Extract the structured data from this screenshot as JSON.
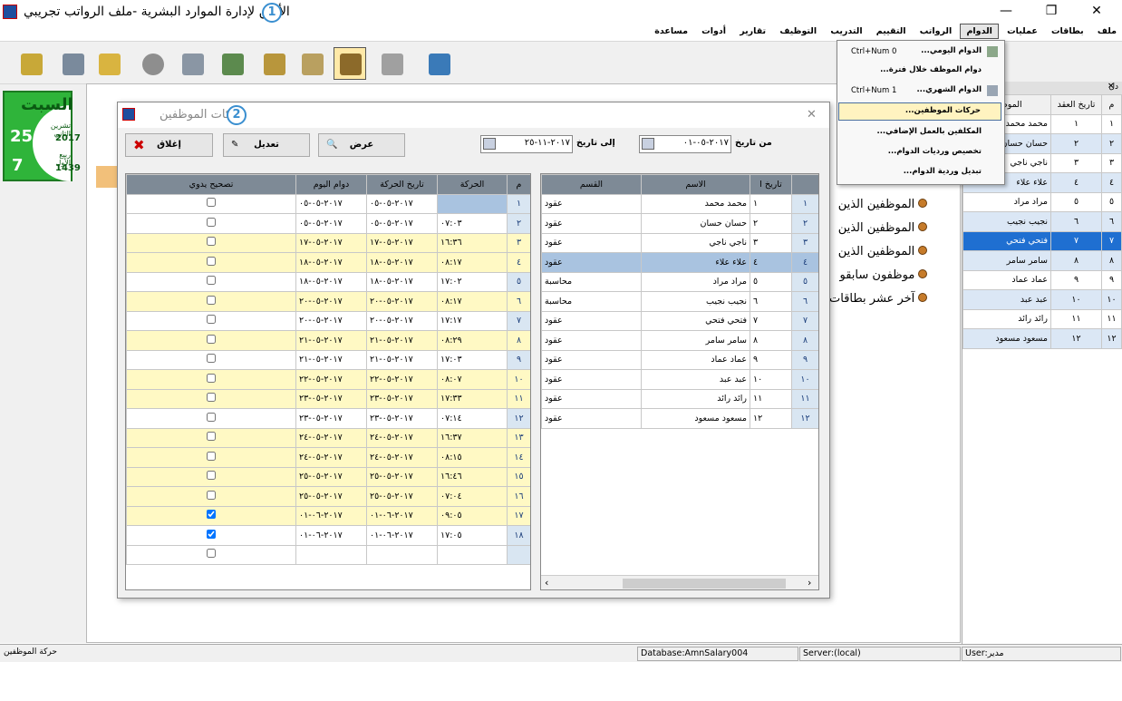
{
  "window": {
    "title": "الأمين لإدارة الموارد البشرية -ملف الرواتب تجريبي",
    "badge1": "1",
    "minimize": "—",
    "maximize": "❐",
    "close": "✕"
  },
  "menu": [
    "ملف",
    "بطاقات",
    "عمليات",
    "الدوام",
    "الرواتب",
    "التقييم",
    "التدريب",
    "التوظيف",
    "تقارير",
    "أدوات",
    "مساعدة"
  ],
  "dropdown": [
    {
      "label": "الدوام اليومي...",
      "shortcut": "Ctrl+Num 0"
    },
    {
      "label": "دوام الموظف خلال فترة...",
      "shortcut": ""
    },
    {
      "label": "الدوام الشهري...",
      "shortcut": "Ctrl+Num 1"
    },
    {
      "label": "حركات الموظفين...",
      "shortcut": ""
    },
    {
      "label": "المكلفين بالعمل الإضافي...",
      "shortcut": ""
    },
    {
      "label": "تخصيص ورديات الدوام...",
      "shortcut": ""
    },
    {
      "label": "تبديل وردية الدوام...",
      "shortcut": ""
    }
  ],
  "date": {
    "day": "السبت",
    "num1": "25",
    "month1": "تشرين الثاني",
    "year1": "2017",
    "num2": "7",
    "month2": "ربيع الأول",
    "year2": "1439"
  },
  "links": [
    "الموظفين الذين",
    "الموظفين الذين",
    "الموظفين الذين",
    "موظفون سابقو",
    "آخر عشر بطاقات"
  ],
  "side": {
    "title": "دل",
    "close": "×",
    "cols": [
      "م",
      "تاريخ العقد",
      "الموظف"
    ],
    "rows": [
      [
        "١",
        "١",
        "محمد محمد"
      ],
      [
        "٢",
        "٢",
        "حسان حسان"
      ],
      [
        "٣",
        "٣",
        "ناجي ناجي"
      ],
      [
        "٤",
        "٤",
        "علاء علاء"
      ],
      [
        "٥",
        "٥",
        "مراد مراد"
      ],
      [
        "٦",
        "٦",
        "نجيب نجيب"
      ],
      [
        "٧",
        "٧",
        "فتحي فتحي"
      ],
      [
        "٨",
        "٨",
        "سامر سامر"
      ],
      [
        "٩",
        "٩",
        "عماد عماد"
      ],
      [
        "١٠",
        "١٠",
        "عبد عبد"
      ],
      [
        "١١",
        "١١",
        "رائد رائد"
      ],
      [
        "١٢",
        "١٢",
        "مسعود مسعود"
      ]
    ]
  },
  "dialog": {
    "title": "حركات الموظفين",
    "badge2": "2",
    "from_label": "من تاريخ",
    "from_value": "٢٠١٧-٠٥-٠١",
    "to_label": "إلى تاريخ",
    "to_value": "٢٠١٧-١١-٢٥",
    "show": "عرض",
    "edit": "تعديل",
    "close": "إغلاق",
    "close_x": "✕",
    "emp_cols": [
      "القسم",
      "الاسم",
      "تاريخ ا"
    ],
    "emp_rows": [
      [
        "١",
        "١",
        "محمد محمد",
        "عقود"
      ],
      [
        "٢",
        "٢",
        "حسان حسان",
        "عقود"
      ],
      [
        "٣",
        "٣",
        "ناجي ناجي",
        "عقود"
      ],
      [
        "٤",
        "٤",
        "علاء علاء",
        "عقود"
      ],
      [
        "٥",
        "٥",
        "مراد مراد",
        "محاسبة"
      ],
      [
        "٦",
        "٦",
        "نجيب نجيب",
        "محاسبة"
      ],
      [
        "٧",
        "٧",
        "فتحي فتحي",
        "عقود"
      ],
      [
        "٨",
        "٨",
        "سامر سامر",
        "عقود"
      ],
      [
        "٩",
        "٩",
        "عماد عماد",
        "عقود"
      ],
      [
        "١٠",
        "١٠",
        "عبد عبد",
        "عقود"
      ],
      [
        "١١",
        "١١",
        "رائد رائد",
        "عقود"
      ],
      [
        "١٢",
        "١٢",
        "مسعود مسعود",
        "عقود"
      ]
    ],
    "mv_cols": [
      "م",
      "الحركة",
      "تاريخ الحركة",
      "دوام اليوم",
      "تصحيح يدوي"
    ],
    "mv_rows": [
      [
        "١",
        "",
        "٢٠١٧-٠٥-٠٥",
        "٢٠١٧-٠٥-٠٥",
        false
      ],
      [
        "٢",
        "٠٧:٠٣",
        "٢٠١٧-٠٥-٠٥",
        "٢٠١٧-٠٥-٠٥",
        false
      ],
      [
        "٣",
        "١٦:٣٦",
        "٢٠١٧-٠٥-١٧",
        "٢٠١٧-٠٥-١٧",
        false
      ],
      [
        "٤",
        "٠٨:١٧",
        "٢٠١٧-٠٥-١٨",
        "٢٠١٧-٠٥-١٨",
        false
      ],
      [
        "٥",
        "١٧:٠٢",
        "٢٠١٧-٠٥-١٨",
        "٢٠١٧-٠٥-١٨",
        false
      ],
      [
        "٦",
        "٠٨:١٧",
        "٢٠١٧-٠٥-٢٠",
        "٢٠١٧-٠٥-٢٠",
        false
      ],
      [
        "٧",
        "١٧:١٧",
        "٢٠١٧-٠٥-٢٠",
        "٢٠١٧-٠٥-٢٠",
        false
      ],
      [
        "٨",
        "٠٨:٢٩",
        "٢٠١٧-٠٥-٢١",
        "٢٠١٧-٠٥-٢١",
        false
      ],
      [
        "٩",
        "١٧:٠٣",
        "٢٠١٧-٠٥-٢١",
        "٢٠١٧-٠٥-٢١",
        false
      ],
      [
        "١٠",
        "٠٨:٠٧",
        "٢٠١٧-٠٥-٢٢",
        "٢٠١٧-٠٥-٢٢",
        false
      ],
      [
        "١١",
        "١٧:٣٣",
        "٢٠١٧-٠٥-٢٣",
        "٢٠١٧-٠٥-٢٣",
        false
      ],
      [
        "١٢",
        "٠٧:١٤",
        "٢٠١٧-٠٥-٢٣",
        "٢٠١٧-٠٥-٢٣",
        false
      ],
      [
        "١٣",
        "١٦:٣٧",
        "٢٠١٧-٠٥-٢٤",
        "٢٠١٧-٠٥-٢٤",
        false
      ],
      [
        "١٤",
        "٠٨:١٥",
        "٢٠١٧-٠٥-٢٤",
        "٢٠١٧-٠٥-٢٤",
        false
      ],
      [
        "١٥",
        "١٦:٤٦",
        "٢٠١٧-٠٥-٢٥",
        "٢٠١٧-٠٥-٢٥",
        false
      ],
      [
        "١٦",
        "٠٧:٠٤",
        "٢٠١٧-٠٥-٢٥",
        "٢٠١٧-٠٥-٢٥",
        false
      ],
      [
        "١٧",
        "٠٩:٠٥",
        "٢٠١٧-٠٦-٠١",
        "٢٠١٧-٠٦-٠١",
        true
      ],
      [
        "١٨",
        "١٧:٠٥",
        "٢٠١٧-٠٦-٠١",
        "٢٠١٧-٠٦-٠١",
        true
      ]
    ]
  },
  "status": {
    "left": "حركة الموظفين",
    "db": "Database:AmnSalary004",
    "server": "Server:(local)",
    "user": "User:مدير"
  },
  "colors": {
    "highlight": "#a9c3e0",
    "yellow": "#fff9c4",
    "green": "#2fb43a"
  }
}
